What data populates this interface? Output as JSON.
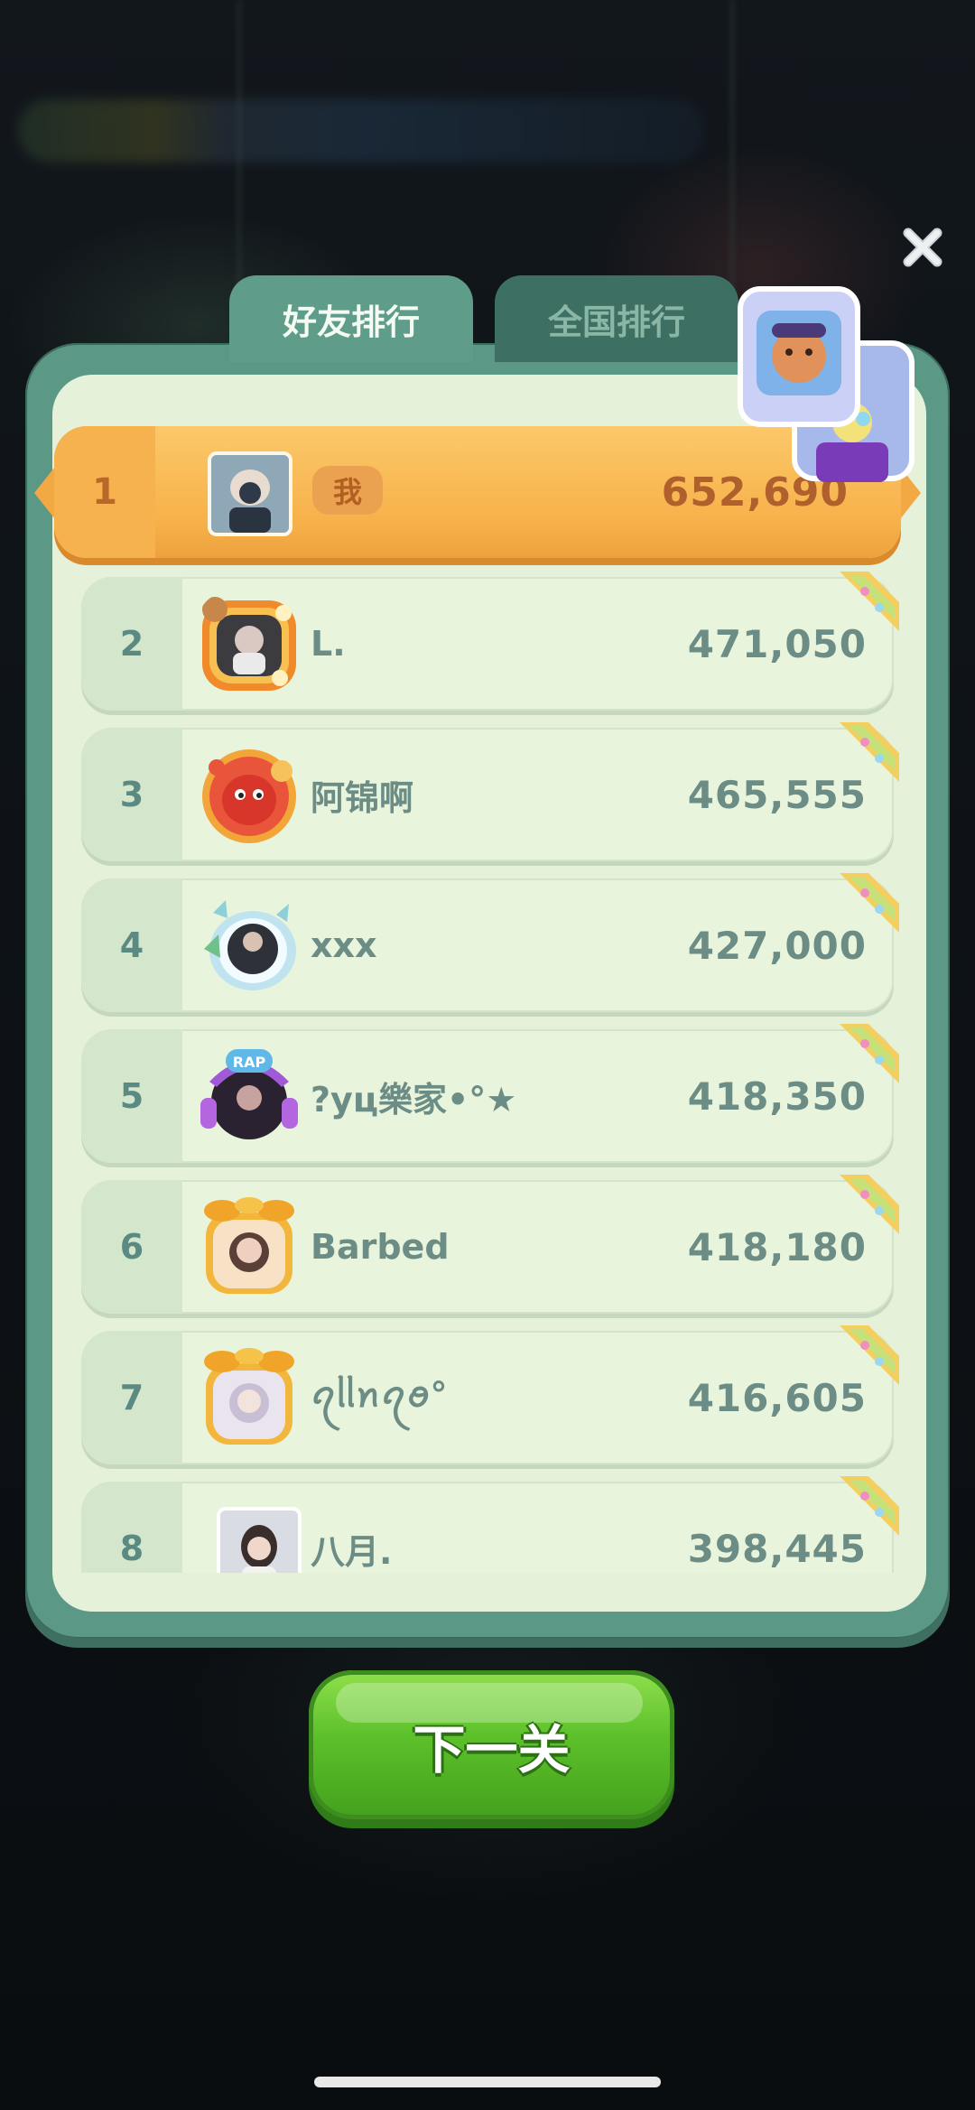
{
  "tabs": {
    "friends": "好友排行",
    "national": "全国排行"
  },
  "me": {
    "rank": "1",
    "badge": "我",
    "score": "652,690"
  },
  "rows": [
    {
      "rank": "2",
      "name": "L.",
      "score": "471,050",
      "avatar": "orange-flower-frame-avatar"
    },
    {
      "rank": "3",
      "name": "阿锦啊",
      "score": "465,555",
      "avatar": "red-monster-avatar"
    },
    {
      "rank": "4",
      "name": "xxx",
      "score": "427,000",
      "avatar": "cloud-frame-avatar"
    },
    {
      "rank": "5",
      "name": "?yц樂家•°★",
      "score": "418,350",
      "avatar": "rap-headphones-frame-avatar"
    },
    {
      "rank": "6",
      "name": "Barbed",
      "score": "418,180",
      "avatar": "golden-tree-frame-avatar"
    },
    {
      "rank": "7",
      "name": "ꪖᥣᥣꪀꪖꪮ°",
      "score": "416,605",
      "avatar": "golden-tree-frame-avatar"
    },
    {
      "rank": "8",
      "name": "八月.",
      "score": "398,445",
      "avatar": "photo-avatar"
    }
  ],
  "next_button": "下一关",
  "colors": {
    "panel": "#5b9886",
    "panel_inner": "#e6f1da",
    "me_bar": "#f7b24b",
    "button_green": "#5cc02a",
    "text_muted": "#6c8c86"
  }
}
